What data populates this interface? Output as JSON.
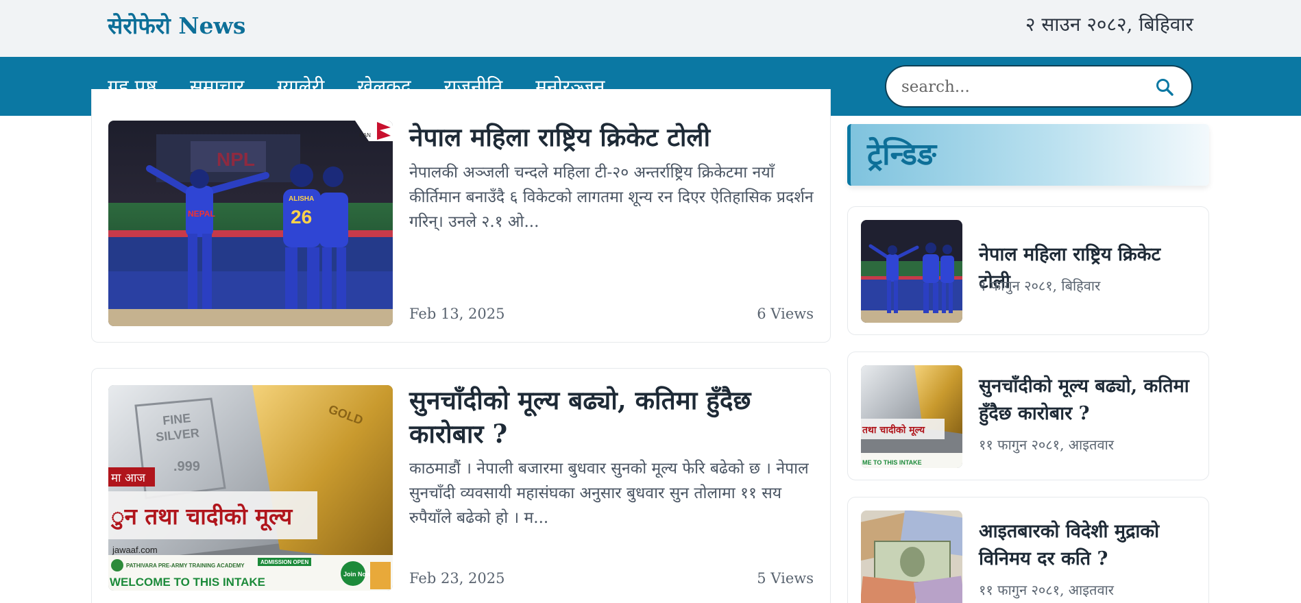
{
  "header": {
    "site_title": "सेरोफेरो News",
    "date": "२ साउन २०८२, बिहिवार"
  },
  "nav": {
    "items": [
      "गृह पृष्ठ",
      "समाचार",
      "ग्यालेरी",
      "खेलकुद",
      "राजनीति",
      "मनोरञ्जन"
    ],
    "search_placeholder": "search..."
  },
  "articles": [
    {
      "title": "नेपाल महिला राष्ट्रिय क्रिकेट टोली",
      "excerpt": "नेपालकी अञ्जली चन्दले महिला टी-२० अन्तर्राष्ट्रिय क्रिकेटमा नयाँ कीर्तिमान बनाउँदै ६ विकेटको लागतमा शून्य रन दिएर ऐतिहासिक प्रदर्शन गरिन्। उनले २.१ ओ...",
      "date": "Feb 13, 2025",
      "views": "6 Views",
      "image": {
        "banner_text": "NPL",
        "jersey_text": "ALISHA",
        "jersey_number": "26",
        "shirt_text": "NEPAL",
        "corner_text": "CAN"
      }
    },
    {
      "title": "सुनचाँदीको मूल्य बढ्यो, कतिमा हुँदैछ कारोबार ?",
      "excerpt": "काठमाडौं । नेपाली बजारमा बुधवार सुनको मूल्य फेरि बढेको छ । नेपाल सुनचाँदी व्यवसायी महासंघका अनुसार बुधवार सुन तोलामा ११ सय रुपैयाँले बढेको हो । म...",
      "date": "Feb 23, 2025",
      "views": "5 Views",
      "image": {
        "tag": "मा आज",
        "headline": "ुन तथा चादीको मूल्य",
        "site": "jawaaf.com",
        "silver_line1": "FINE",
        "silver_line2": "SILVER",
        "silver_purity": ".999",
        "gold_text": "GOLD",
        "ad_line1": "PATHIVARA PRE-ARMY TRAINING ACADEMY",
        "ad_line2": "WELCOME TO THIS INTAKE",
        "ad_badge": "ADMISSION OPEN",
        "ad_button": "Join Now"
      }
    }
  ],
  "trending": {
    "title": "ट्रेन्डिङ",
    "items": [
      {
        "title": "नेपाल महिला राष्ट्रिय क्रिकेट टोली",
        "date": "१ फागुन २०८१, बिहिवार"
      },
      {
        "title": "सुनचाँदीको मूल्य बढ्यो, कतिमा हुँदैछ कारोबार ?",
        "date": "११ फागुन २०८१, आइतवार",
        "thumb_text": "तथा चादीको मूल्य",
        "thumb_ad": "ME TO THIS INTAKE"
      },
      {
        "title": "आइतबारको विदेशी मुद्राको विनिमय दर कति ?",
        "date": "११ फागुन २०८१, आइतवार"
      }
    ]
  },
  "colors": {
    "brand": "#0b78a3",
    "title_blue": "#0d6f98",
    "topbar_bg": "#f1f3f5",
    "gold": "#c99a2e",
    "silver": "#b9bec4",
    "headline_red": "#b0151c"
  },
  "icons": {
    "search": "search-icon"
  }
}
